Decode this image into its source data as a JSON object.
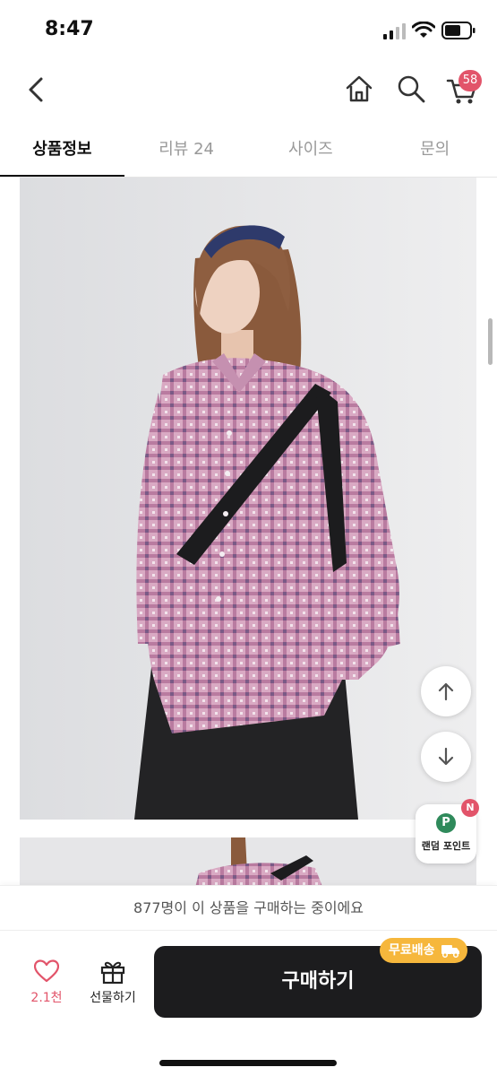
{
  "status_bar": {
    "time": "8:47"
  },
  "nav": {
    "cart_count": "58"
  },
  "tabs": [
    {
      "label": "상품정보"
    },
    {
      "label": "리뷰 24"
    },
    {
      "label": "사이즈"
    },
    {
      "label": "문의"
    }
  ],
  "points_widget": {
    "icon_letter": "P",
    "label": "랜덤 포인트",
    "badge": "N"
  },
  "bottom": {
    "buying_text": "877명이 이 상품을 구매하는 중이에요",
    "like_count": "2.1천",
    "gift_label": "선물하기",
    "buy_label": "구매하기",
    "free_shipping": "무료배송"
  },
  "colors": {
    "accent": "#e2546a",
    "buy_button": "#1c1c1e",
    "free_shipping": "#f6b73c",
    "points_green": "#2f8a5b"
  }
}
